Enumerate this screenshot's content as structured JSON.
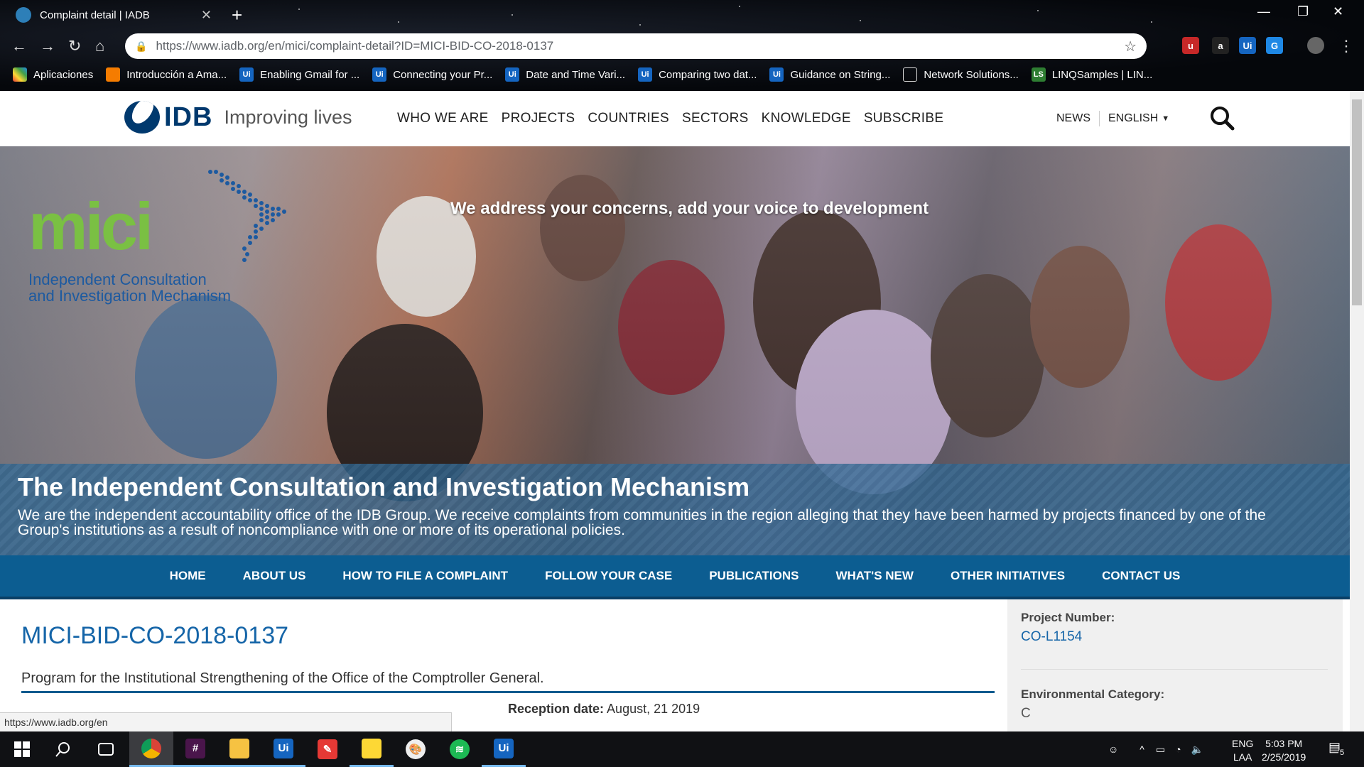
{
  "browser": {
    "tab_title": "Complaint detail | IADB",
    "url": "https://www.iadb.org/en/mici/complaint-detail?ID=MICI-BID-CO-2018-0137",
    "bookmarks": [
      {
        "label": "Aplicaciones",
        "icon": "apps-grid-icon"
      },
      {
        "label": "Introducción a Ama...",
        "icon": "aws-icon"
      },
      {
        "label": "Enabling Gmail for ...",
        "icon": "uipath-icon"
      },
      {
        "label": "Connecting your Pr...",
        "icon": "uipath-icon"
      },
      {
        "label": "Date and Time Vari...",
        "icon": "uipath-icon"
      },
      {
        "label": "Comparing two dat...",
        "icon": "uipath-icon"
      },
      {
        "label": "Guidance on String...",
        "icon": "uipath-icon"
      },
      {
        "label": "Network Solutions...",
        "icon": "page-icon"
      },
      {
        "label": "LINQSamples | LIN...",
        "icon": "linq-icon"
      }
    ],
    "status_url": "https://www.iadb.org/en"
  },
  "site": {
    "logo_text": "IDB",
    "tagline": "Improving lives",
    "main_nav": [
      "WHO WE ARE",
      "PROJECTS",
      "COUNTRIES",
      "SECTORS",
      "KNOWLEDGE",
      "SUBSCRIBE"
    ],
    "news": "NEWS",
    "language": "ENGLISH"
  },
  "hero": {
    "mici_word": "mici",
    "mici_subtitle_1": "Independent Consultation",
    "mici_subtitle_2": "and Investigation Mechanism",
    "tagline": "We address your concerns, add your voice to development",
    "title": "The Independent Consultation and Investigation Mechanism",
    "description": "We are the independent accountability office of the IDB Group. We receive complaints from communities in the region alleging that they have been harmed by projects financed by one of the Group's institutions as a result of noncompliance with one or more of its operational policies."
  },
  "section_nav": [
    "HOME",
    "ABOUT US",
    "HOW TO FILE A COMPLAINT",
    "FOLLOW YOUR CASE",
    "PUBLICATIONS",
    "WHAT'S NEW",
    "OTHER INITIATIVES",
    "CONTACT US"
  ],
  "complaint": {
    "id": "MICI-BID-CO-2018-0137",
    "description": "Program for the Institutional Strengthening of the Office of the Comptroller General.",
    "reception_label": "Reception date:",
    "reception_value": "August, 21 2019"
  },
  "sidebar": {
    "project_number_label": "Project Number:",
    "project_number_value": "CO-L1154",
    "env_category_label": "Environmental Category:",
    "env_category_value": "C"
  },
  "taskbar": {
    "lang_top": "ENG",
    "lang_bottom": "LAA",
    "time": "5:03 PM",
    "date": "2/25/2019",
    "notifications": "5",
    "apps": [
      "start-icon",
      "search-icon",
      "task-view-icon",
      "chrome-icon",
      "slack-icon",
      "file-explorer-icon",
      "uipath-icon",
      "pin-app-icon",
      "sticky-notes-icon",
      "paint-icon",
      "spotify-icon",
      "uipath-robot-icon"
    ]
  },
  "colors": {
    "idb_blue": "#00396e",
    "mici_green": "#7ac043",
    "nav_blue": "#0c5d91",
    "link_blue": "#1565a8"
  }
}
